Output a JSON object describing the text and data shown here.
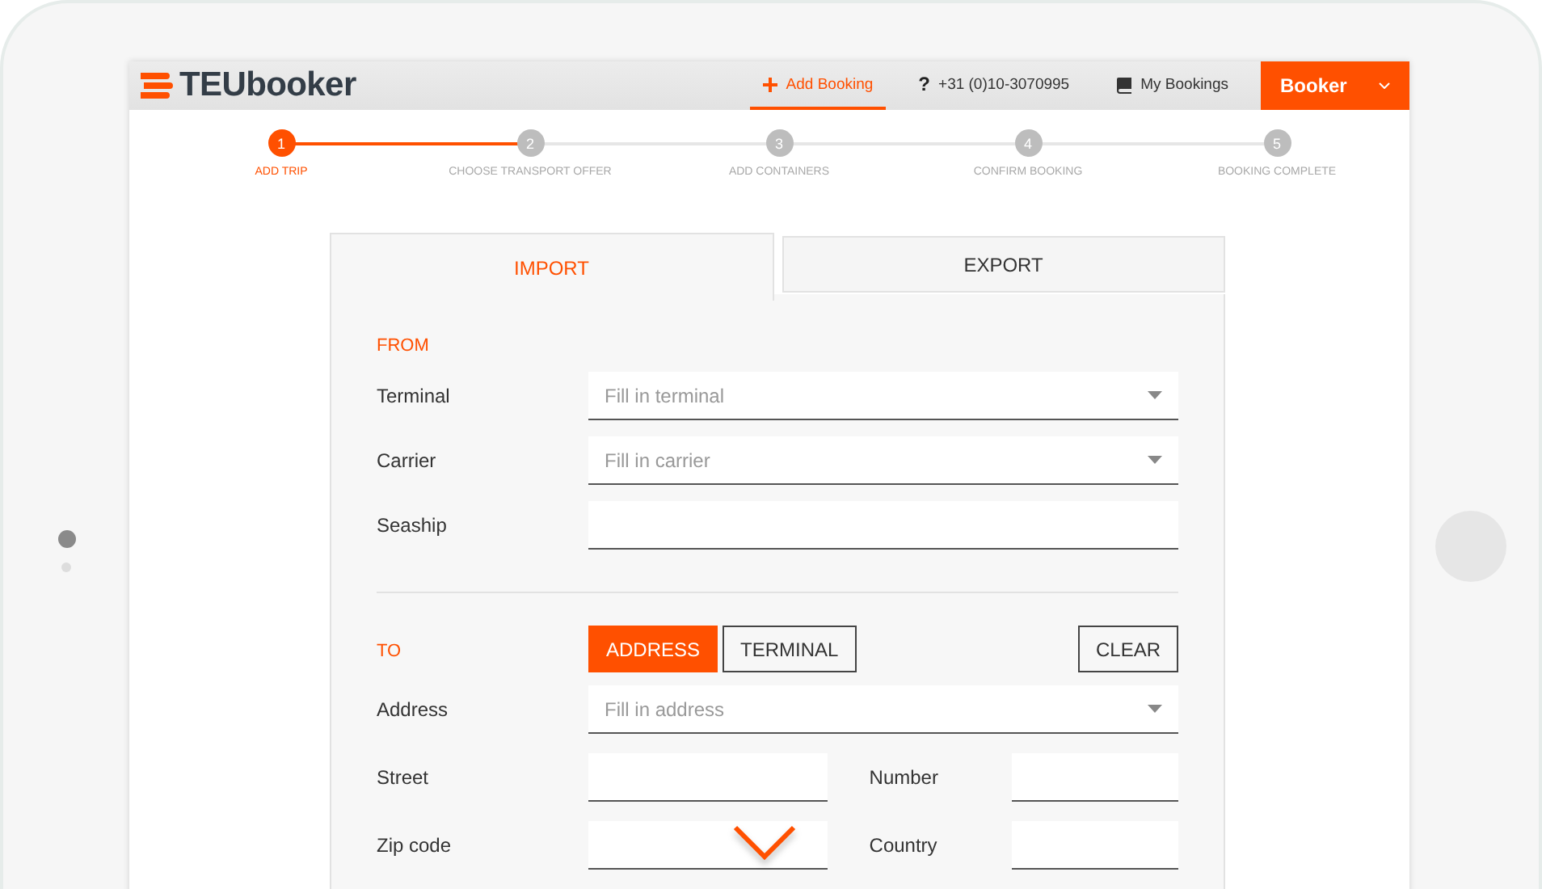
{
  "header": {
    "logo": "TEUbooker",
    "nav": [
      {
        "kind": "add",
        "label": "Add Booking",
        "selected": true
      },
      {
        "kind": "help",
        "glyph": "?",
        "label": "+31 (0)10-3070995",
        "selected": false
      },
      {
        "kind": "bookings",
        "label": "My Bookings",
        "selected": false
      }
    ],
    "user": "Booker"
  },
  "steps": [
    {
      "number": "1",
      "label": "ADD TRIP",
      "selected": true
    },
    {
      "number": "2",
      "label": "CHOOSE TRANSPORT OFFER",
      "selected": false
    },
    {
      "number": "3",
      "label": "ADD CONTAINERS",
      "selected": false
    },
    {
      "number": "4",
      "label": "CONFIRM BOOKING",
      "selected": false
    },
    {
      "number": "5",
      "label": "BOOKING COMPLETE",
      "selected": false
    }
  ],
  "tabs": [
    {
      "label": "IMPORT",
      "selected": true
    },
    {
      "label": "EXPORT",
      "selected": false
    }
  ],
  "from": {
    "heading": "FROM",
    "fields": [
      {
        "kind": "dropdown",
        "label": "Terminal",
        "placeholder": "Fill in terminal"
      },
      {
        "kind": "dropdown",
        "label": "Carrier",
        "placeholder": "Fill in carrier"
      },
      {
        "kind": "text",
        "label": "Seaship"
      }
    ]
  },
  "to": {
    "heading": "TO",
    "toggle": [
      {
        "label": "ADDRESS",
        "selected": true
      },
      {
        "label": "TERMINAL",
        "selected": false
      }
    ],
    "clear": "CLEAR",
    "address": {
      "kind": "dropdown",
      "label": "Address",
      "placeholder": "Fill in address"
    },
    "pairs": [
      [
        {
          "label": "Street"
        },
        {
          "label": "Number"
        }
      ],
      [
        {
          "label": "Zip code"
        },
        {
          "label": "Country"
        }
      ]
    ]
  }
}
